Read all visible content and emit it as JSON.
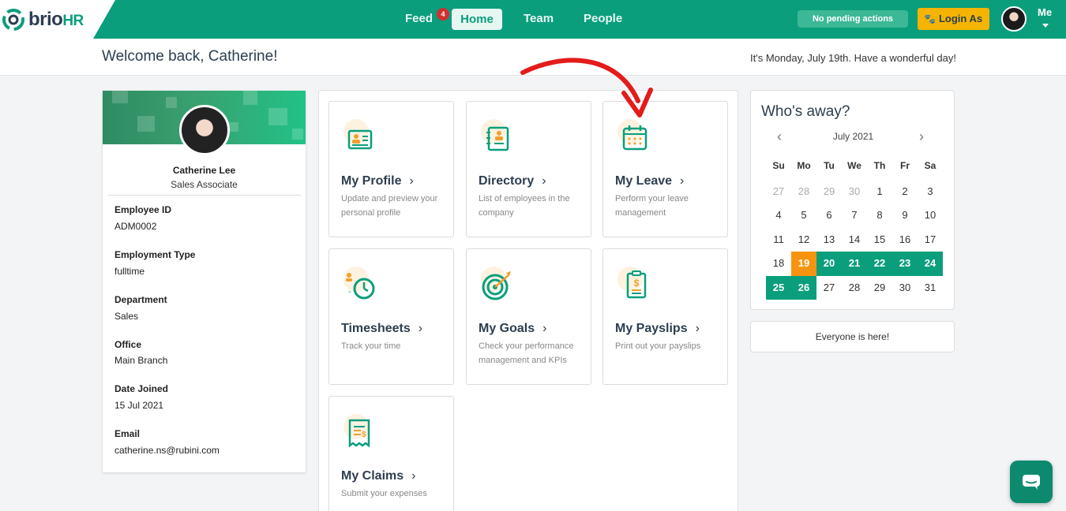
{
  "brand": {
    "name": "brio",
    "suffix": "HR",
    "color": "#0a9e7d"
  },
  "nav": {
    "feed": "Feed",
    "feed_badge": "4",
    "home": "Home",
    "team": "Team",
    "people": "People",
    "pending": "No pending actions",
    "login_as": "Login As",
    "me": "Me"
  },
  "welcome": {
    "title": "Welcome back, Catherine!",
    "date_message": "It's Monday, July 19th. Have a wonderful day!"
  },
  "profile": {
    "name": "Catherine Lee",
    "role": "Sales Associate",
    "fields": [
      {
        "label": "Employee ID",
        "value": "ADM0002"
      },
      {
        "label": "Employment Type",
        "value": "fulltime"
      },
      {
        "label": "Department",
        "value": "Sales"
      },
      {
        "label": "Office",
        "value": "Main Branch"
      },
      {
        "label": "Date Joined",
        "value": "15 Jul 2021"
      },
      {
        "label": "Email",
        "value": "catherine.ns@rubini.com"
      }
    ]
  },
  "tiles": [
    {
      "title": "My Profile",
      "desc": "Update and preview your personal profile",
      "icon": "profile-card-icon"
    },
    {
      "title": "Directory",
      "desc": "List of employees in the company",
      "icon": "directory-book-icon"
    },
    {
      "title": "My Leave",
      "desc": "Perform your leave management",
      "icon": "calendar-icon"
    },
    {
      "title": "Timesheets",
      "desc": "Track your time",
      "icon": "clock-icon"
    },
    {
      "title": "My Goals",
      "desc": "Check your performance management and KPIs",
      "icon": "target-icon"
    },
    {
      "title": "My Payslips",
      "desc": "Print out your payslips",
      "icon": "payslip-icon"
    },
    {
      "title": "My Claims",
      "desc": "Submit your expenses",
      "icon": "receipt-icon"
    }
  ],
  "calendar": {
    "title": "Who's away?",
    "month": "July 2021",
    "weekdays": [
      "Su",
      "Mo",
      "Tu",
      "We",
      "Th",
      "Fr",
      "Sa"
    ],
    "weeks": [
      [
        "27",
        "28",
        "29",
        "30",
        "1",
        "2",
        "3"
      ],
      [
        "4",
        "5",
        "6",
        "7",
        "8",
        "9",
        "10"
      ],
      [
        "11",
        "12",
        "13",
        "14",
        "15",
        "16",
        "17"
      ],
      [
        "18",
        "19",
        "20",
        "21",
        "22",
        "23",
        "24"
      ],
      [
        "25",
        "26",
        "27",
        "28",
        "29",
        "30",
        "31"
      ]
    ],
    "today": "19",
    "away_days": [
      "20",
      "21",
      "22",
      "23",
      "24",
      "25",
      "26"
    ],
    "colors": {
      "away": "#0a9e7d",
      "today": "#f7940f"
    }
  },
  "everyone_here": "Everyone is here!"
}
